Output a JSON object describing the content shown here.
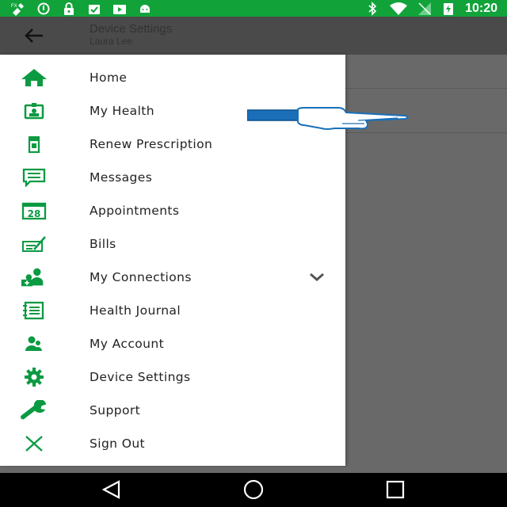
{
  "status_bar": {
    "time": "10:20",
    "color": "#11a33a"
  },
  "app_bar": {
    "title": "Device Settings",
    "subtitle": "Laura Lee"
  },
  "drawer": {
    "accent_color": "#0b9a42",
    "items": [
      {
        "label": "Home",
        "icon": "home-icon"
      },
      {
        "label": "My Health",
        "icon": "id-card-icon"
      },
      {
        "label": "Renew Prescription",
        "icon": "pill-bottle-icon"
      },
      {
        "label": "Messages",
        "icon": "chat-icon"
      },
      {
        "label": "Appointments",
        "icon": "calendar-icon"
      },
      {
        "label": "Bills",
        "icon": "check-bill-icon"
      },
      {
        "label": "My Connections",
        "icon": "connections-icon",
        "expandable": true
      },
      {
        "label": "Health Journal",
        "icon": "journal-icon"
      },
      {
        "label": "My Account",
        "icon": "account-icon"
      },
      {
        "label": "Device Settings",
        "icon": "gear-icon"
      },
      {
        "label": "Support",
        "icon": "wrench-icon"
      },
      {
        "label": "Sign Out",
        "icon": "close-icon"
      }
    ]
  }
}
